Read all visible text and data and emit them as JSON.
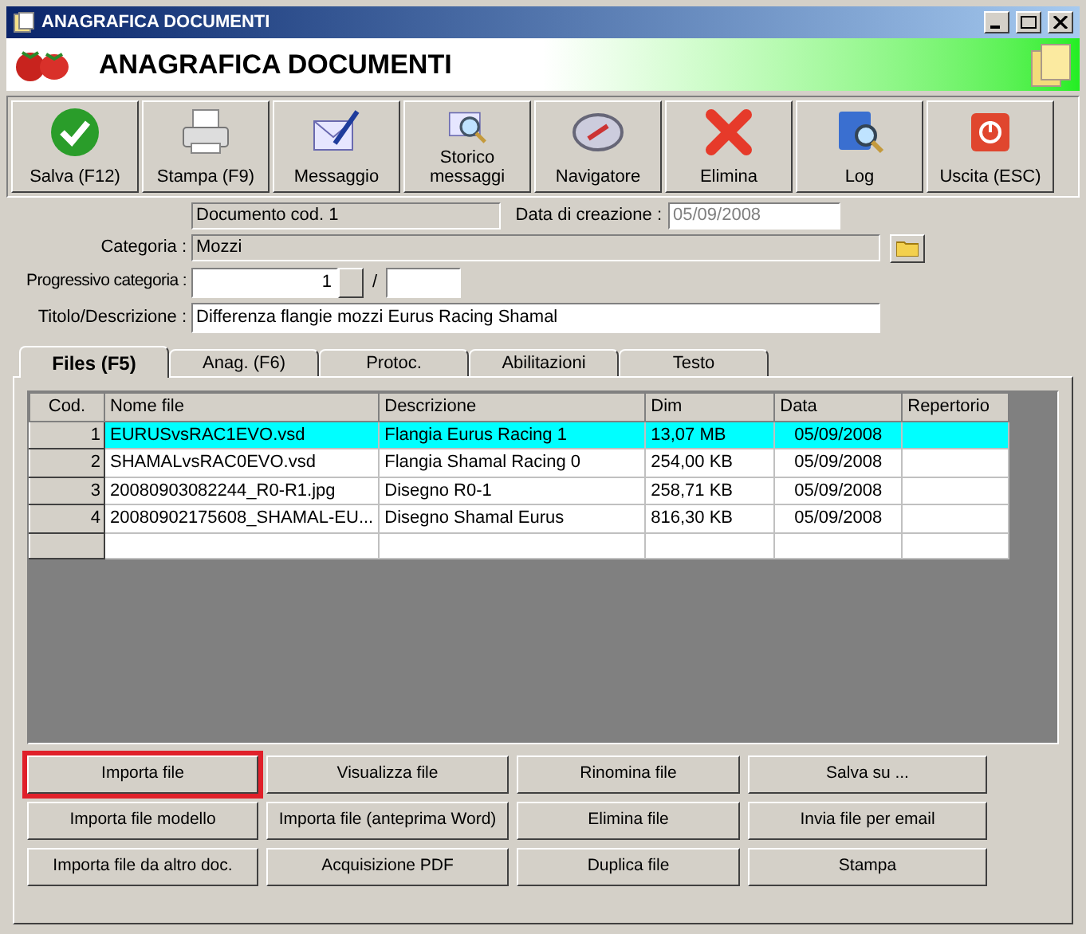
{
  "window": {
    "title": "ANAGRAFICA DOCUMENTI"
  },
  "header": {
    "title": "ANAGRAFICA DOCUMENTI"
  },
  "toolbar": [
    {
      "label": "Salva (F12)",
      "kind": "save"
    },
    {
      "label": "Stampa (F9)",
      "kind": "print"
    },
    {
      "label": "Messaggio",
      "kind": "message"
    },
    {
      "label": "Storico messaggi",
      "kind": "history"
    },
    {
      "label": "Navigatore",
      "kind": "compass"
    },
    {
      "label": "Elimina",
      "kind": "delete"
    },
    {
      "label": "Log",
      "kind": "log"
    },
    {
      "label": "Uscita (ESC)",
      "kind": "exit"
    }
  ],
  "form": {
    "document_code": "Documento cod. 1",
    "created_label": "Data di creazione :",
    "created_value": "05/09/2008",
    "category_label": "Categoria :",
    "category_value": "Mozzi",
    "progressive_label": "Progressivo categoria :",
    "progressive_value": "1",
    "progressive_separator": "/",
    "title_label": "Titolo/Descrizione :",
    "title_value": "Differenza flangie mozzi Eurus Racing Shamal"
  },
  "tabs": [
    {
      "label": "Files (F5)",
      "selected": true
    },
    {
      "label": "Anag. (F6)",
      "selected": false
    },
    {
      "label": "Protoc.",
      "selected": false
    },
    {
      "label": "Abilitazioni",
      "selected": false
    },
    {
      "label": "Testo",
      "selected": false
    }
  ],
  "table": {
    "columns": [
      "Cod.",
      "Nome file",
      "Descrizione",
      "Dim",
      "Data",
      "Repertorio"
    ],
    "rows": [
      {
        "cells": [
          "1",
          "EURUSvsRAC1EVO.vsd",
          "Flangia Eurus Racing 1",
          "13,07 MB",
          "05/09/2008"
        ],
        "selected": true
      },
      {
        "cells": [
          "2",
          "SHAMALvsRAC0EVO.vsd",
          "Flangia Shamal Racing 0",
          "254,00 KB",
          "05/09/2008"
        ],
        "selected": false
      },
      {
        "cells": [
          "3",
          "20080903082244_R0-R1.jpg",
          "Disegno R0-1",
          "258,71 KB",
          "05/09/2008"
        ],
        "selected": false
      },
      {
        "cells": [
          "4",
          "20080902175608_SHAMAL-EU...",
          "Disegno Shamal Eurus",
          "816,30 KB",
          "05/09/2008"
        ],
        "selected": false
      }
    ]
  },
  "buttons": [
    {
      "label": "Importa file",
      "highlighted": true
    },
    {
      "label": "Visualizza file",
      "highlighted": false
    },
    {
      "label": "Rinomina file",
      "highlighted": false
    },
    {
      "label": "Salva su ...",
      "highlighted": false
    },
    {
      "label": "Importa file modello",
      "highlighted": false
    },
    {
      "label": "Importa file (anteprima Word)",
      "highlighted": false
    },
    {
      "label": "Elimina file",
      "highlighted": false
    },
    {
      "label": "Invia file per email",
      "highlighted": false
    },
    {
      "label": "Importa file da altro doc.",
      "highlighted": false
    },
    {
      "label": "Acquisizione PDF",
      "highlighted": false
    },
    {
      "label": "Duplica file",
      "highlighted": false
    },
    {
      "label": "Stampa",
      "highlighted": false
    }
  ]
}
